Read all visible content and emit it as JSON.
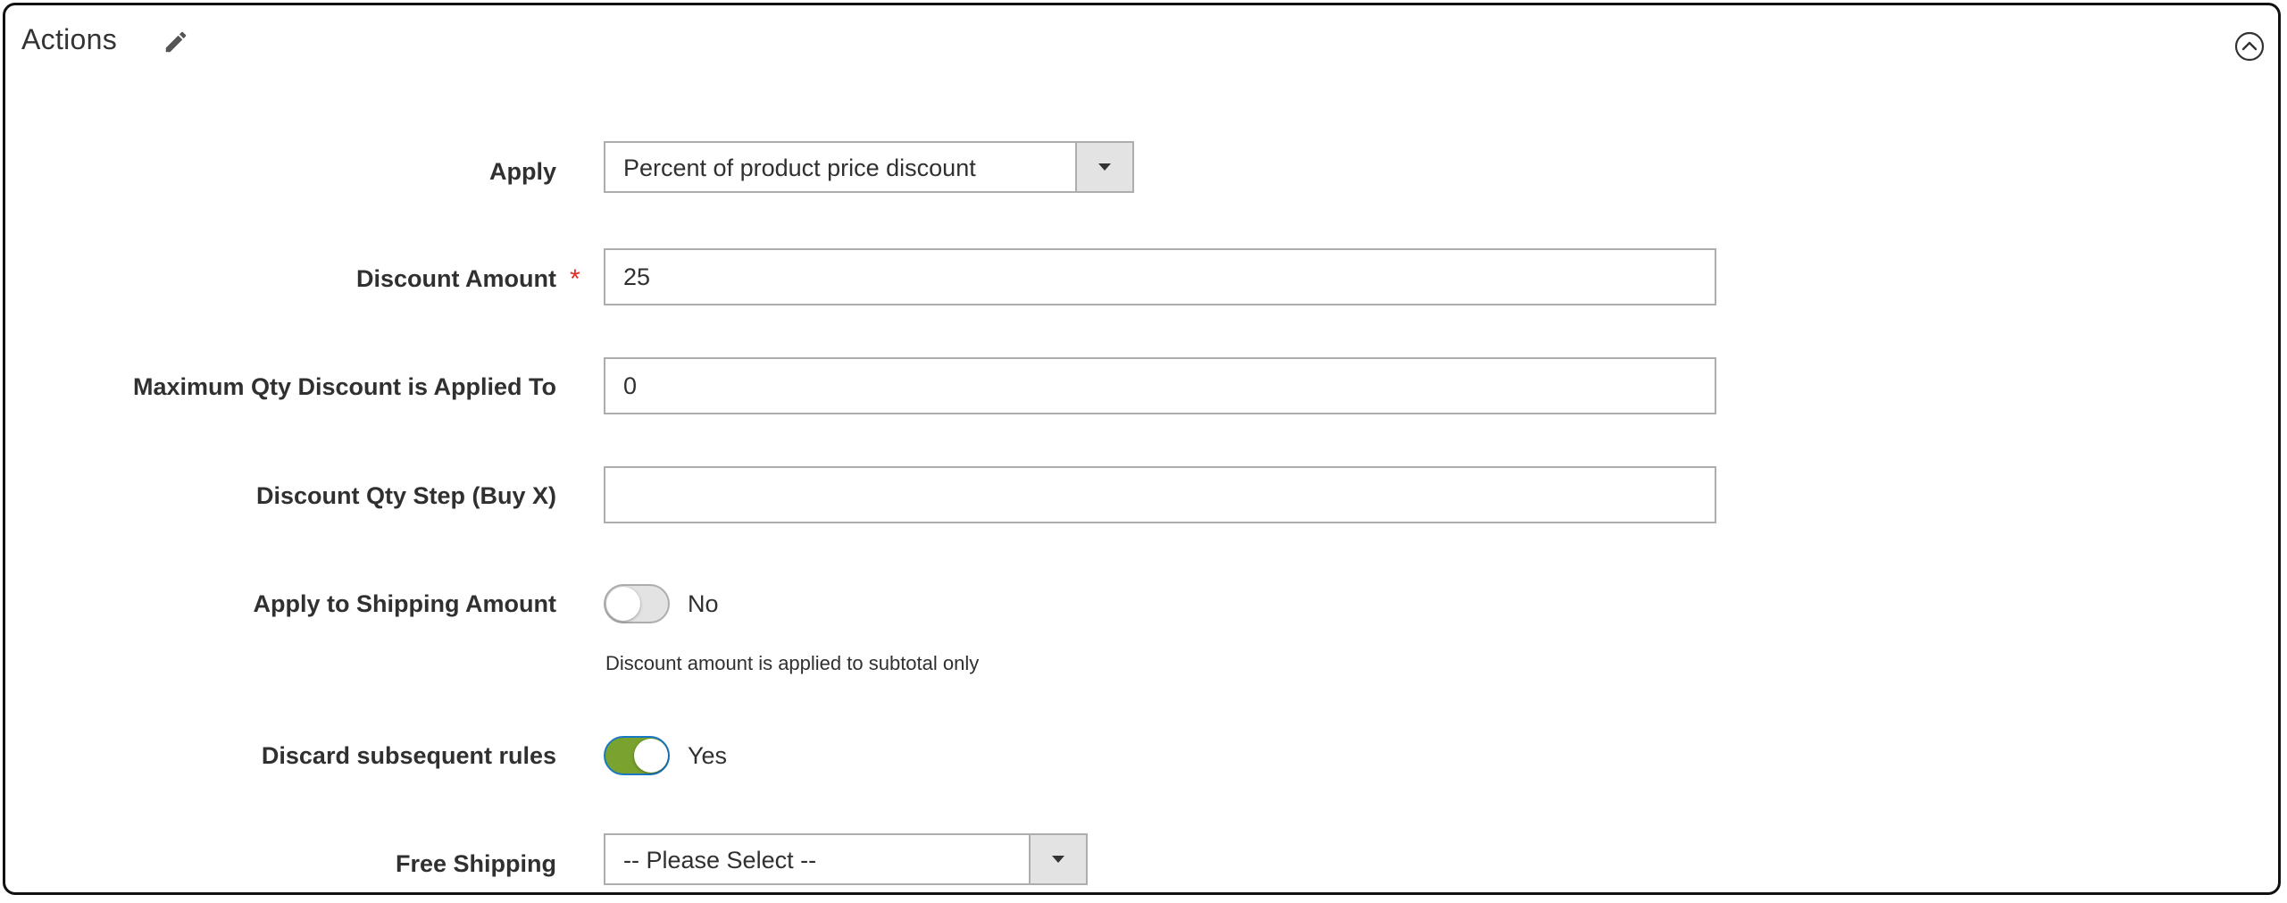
{
  "section": {
    "title": "Actions",
    "edit_icon": "pencil-icon",
    "collapse_icon": "chevron-up-circle-icon"
  },
  "form": {
    "apply": {
      "label": "Apply",
      "selected": "Percent of product price discount"
    },
    "discount_amount": {
      "label": "Discount Amount",
      "required_mark": "*",
      "value": "25"
    },
    "max_qty": {
      "label": "Maximum Qty Discount is Applied To",
      "value": "0"
    },
    "qty_step": {
      "label": "Discount Qty Step (Buy X)",
      "value": ""
    },
    "apply_shipping": {
      "label": "Apply to Shipping Amount",
      "state": "No",
      "note": "Discount amount is applied to subtotal only"
    },
    "discard_rules": {
      "label": "Discard subsequent rules",
      "state": "Yes"
    },
    "free_shipping": {
      "label": "Free Shipping",
      "selected": "-- Please Select --"
    }
  },
  "colors": {
    "border": "#adadad",
    "required": "#e02b27",
    "toggle_on": "#79a22e",
    "toggle_focus": "#1979c3",
    "select_arrow_bg": "#e3e3e3"
  }
}
